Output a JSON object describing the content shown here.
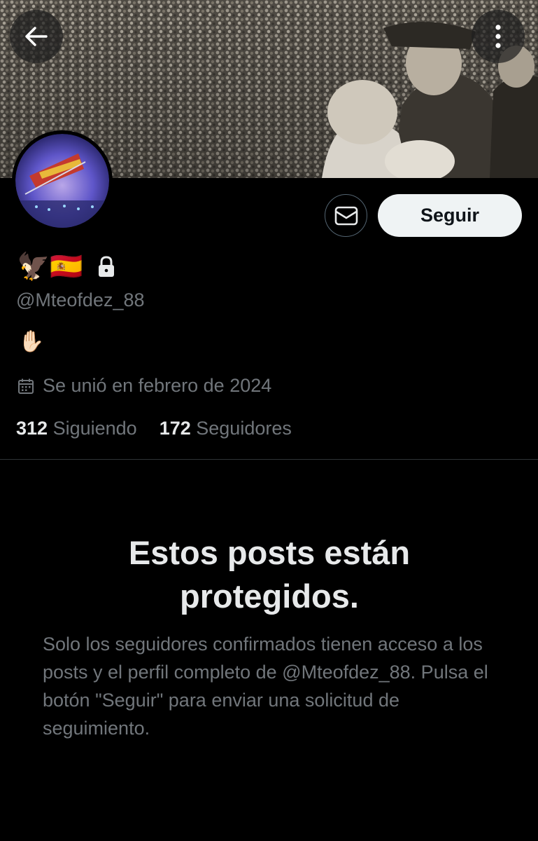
{
  "header": {
    "back_icon": "arrow-left-icon",
    "more_icon": "more-vertical-icon",
    "banner_image": "sepia crowd photograph with uniformed officials"
  },
  "profile": {
    "display_name_emojis": "🦅🇪🇸",
    "lock_icon": "lock-icon",
    "handle": "@Mteofdez_88",
    "bio": "✋🏻",
    "joined": "Se unió en febrero de 2024",
    "following_count": "312",
    "following_label": "Siguiendo",
    "followers_count": "172",
    "followers_label": "Seguidores"
  },
  "actions": {
    "message_icon": "envelope-icon",
    "follow_label": "Seguir"
  },
  "protected": {
    "title": "Estos posts están protegidos.",
    "description": "Solo los seguidores confirmados tienen acceso a los posts y el perfil completo de @Mteofdez_88. Pulsa el botón \"Seguir\" para enviar una solicitud de seguimiento."
  },
  "colors": {
    "background": "#000000",
    "primary_text": "#e7e9ea",
    "secondary_text": "#71767b",
    "follow_button_bg": "#eff3f4",
    "border": "#2f3336"
  }
}
